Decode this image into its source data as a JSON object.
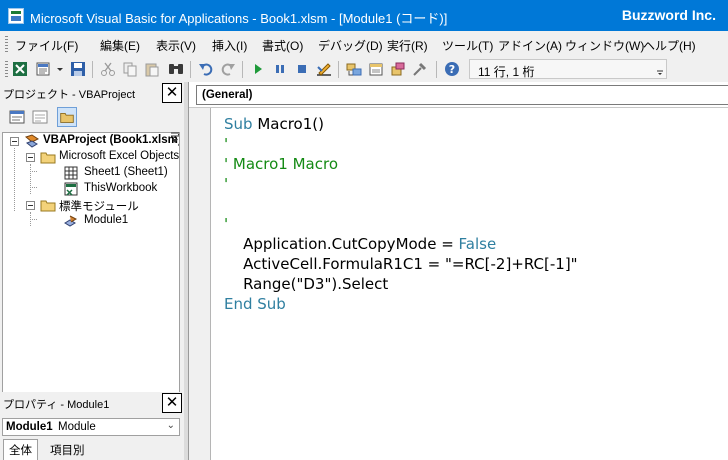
{
  "window": {
    "title": "Microsoft Visual Basic for Applications - Book1.xlsm - [Module1 (コード)]",
    "brand": "Buzzword Inc."
  },
  "menu": [
    "ファイル(F)",
    "編集(E)",
    "表示(V)",
    "挿入(I)",
    "書式(O)",
    "デバッグ(D)",
    "実行(R)",
    "ツール(T)",
    "アドイン(A)",
    "ウィンドウ(W)",
    "ヘルプ(H)"
  ],
  "toolbar": {
    "icons": [
      "view-excel-icon",
      "insert-module-icon",
      "save-icon",
      "cut-icon",
      "copy-icon",
      "paste-icon",
      "find-icon",
      "undo-icon",
      "redo-icon",
      "run-icon",
      "break-icon",
      "reset-icon",
      "design-mode-icon",
      "project-explorer-icon",
      "properties-icon",
      "object-browser-icon",
      "toolbox-icon",
      "help-icon"
    ],
    "position_label": "11 行, 1 桁"
  },
  "project_pane": {
    "title": "プロジェクト - VBAProject",
    "close": "✕",
    "tree": [
      {
        "label": "VBAProject (Book1.xlsm)",
        "level": 0,
        "icon": "vba-project-icon",
        "bold": true
      },
      {
        "label": "Microsoft Excel Objects",
        "level": 1,
        "icon": "folder-icon"
      },
      {
        "label": "Sheet1 (Sheet1)",
        "level": 2,
        "icon": "worksheet-icon"
      },
      {
        "label": "ThisWorkbook",
        "level": 2,
        "icon": "workbook-icon"
      },
      {
        "label": "標準モジュール",
        "level": 1,
        "icon": "folder-icon"
      },
      {
        "label": "Module1",
        "level": 2,
        "icon": "module-icon"
      }
    ]
  },
  "properties_pane": {
    "title": "プロパティ - Module1",
    "close": "✕",
    "object_name": "Module1",
    "object_type": "Module",
    "tabs": [
      "全体",
      "項目別"
    ]
  },
  "code_window": {
    "object_combo": "(General)",
    "lines": [
      [
        {
          "t": "Sub",
          "c": "kw"
        },
        {
          "t": " Macro1()",
          "c": ""
        }
      ],
      [
        {
          "t": "'",
          "c": "cm"
        }
      ],
      [
        {
          "t": "' Macro1 Macro",
          "c": "cm"
        }
      ],
      [
        {
          "t": "'",
          "c": "cm"
        }
      ],
      [
        {
          "t": "",
          "c": ""
        }
      ],
      [
        {
          "t": "'",
          "c": "cm"
        }
      ],
      [
        {
          "t": "    Application.CutCopyMode = ",
          "c": ""
        },
        {
          "t": "False",
          "c": "kw"
        }
      ],
      [
        {
          "t": "    ActiveCell.FormulaR1C1 = \"=RC[-2]+RC[-1]\"",
          "c": ""
        }
      ],
      [
        {
          "t": "    Range(\"D3\").Select",
          "c": ""
        }
      ],
      [
        {
          "t": "End Sub",
          "c": "kw"
        }
      ]
    ]
  },
  "colors": {
    "titlebar": "#0078d7",
    "keyword": "#2f7fa0",
    "comment": "#148a14"
  }
}
